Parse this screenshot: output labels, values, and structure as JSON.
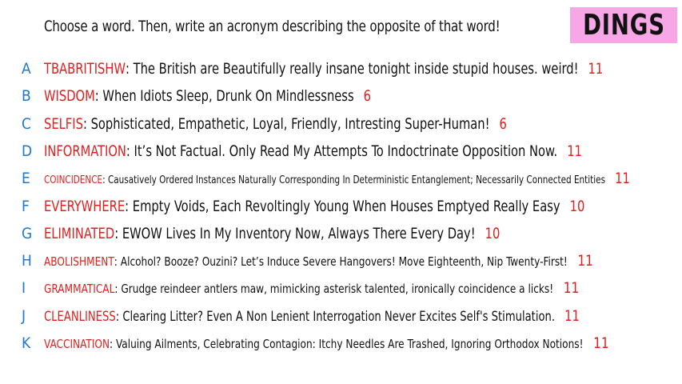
{
  "prompt": "Choose a word. Then, write an acronym describing the opposite of that word!",
  "badge": "DINGS",
  "entries": [
    {
      "letter": "A",
      "word": "TBABRITISHW",
      "acronym": "The British are Beautifully really insane tonight inside stupid houses. weird!",
      "score": "11"
    },
    {
      "letter": "B",
      "word": "WISDOM",
      "acronym": "When Idiots Sleep, Drunk On Mindlessness",
      "score": "6"
    },
    {
      "letter": "C",
      "word": "SELFIS",
      "acronym": "Sophisticated, Empathetic, Loyal, Friendly, Intresting Super-Human!",
      "score": "6"
    },
    {
      "letter": "D",
      "word": "INFORMATION",
      "acronym": "It’s Not Factual. Only Read My Attempts To Indoctrinate Opposition Now.",
      "score": "11"
    },
    {
      "letter": "E",
      "word": "COINCIDENCE",
      "acronym": "Causatively Ordered Instances Naturally Corresponding In Deterministic Entanglement; Necessarily Connected Entities",
      "score": "11"
    },
    {
      "letter": "F",
      "word": "EVERYWHERE",
      "acronym": "Empty Voids, Each Revoltingly Young When Houses Emptyed Really Easy",
      "score": "10"
    },
    {
      "letter": "G",
      "word": "ELIMINATED",
      "acronym": "EWOW Lives In My Inventory Now, Always There Every Day!",
      "score": "10"
    },
    {
      "letter": "H",
      "word": "ABOLISHMENT",
      "acronym": "Alcohol? Booze? Ouzini? Let’s Induce Severe Hangovers! Move Eighteenth, Nip Twenty-First!",
      "score": "11"
    },
    {
      "letter": "I",
      "word": "GRAMMATICAL",
      "acronym": "Grudge reindeer antlers maw, mimicking asterisk talented, ironically coincidence a licks!",
      "score": "11"
    },
    {
      "letter": "J",
      "word": "CLEANLINESS",
      "acronym": "Clearing Litter? Even A Non Lenient Interrogation Never Excites Self's Stimulation.",
      "score": "11"
    },
    {
      "letter": "K",
      "word": "VACCINATION",
      "acronym": "Valuing Ailments, Celebrating Contagion: Itchy Needles Are Trashed, Ignoring Orthodox Notions!",
      "score": "11"
    }
  ]
}
